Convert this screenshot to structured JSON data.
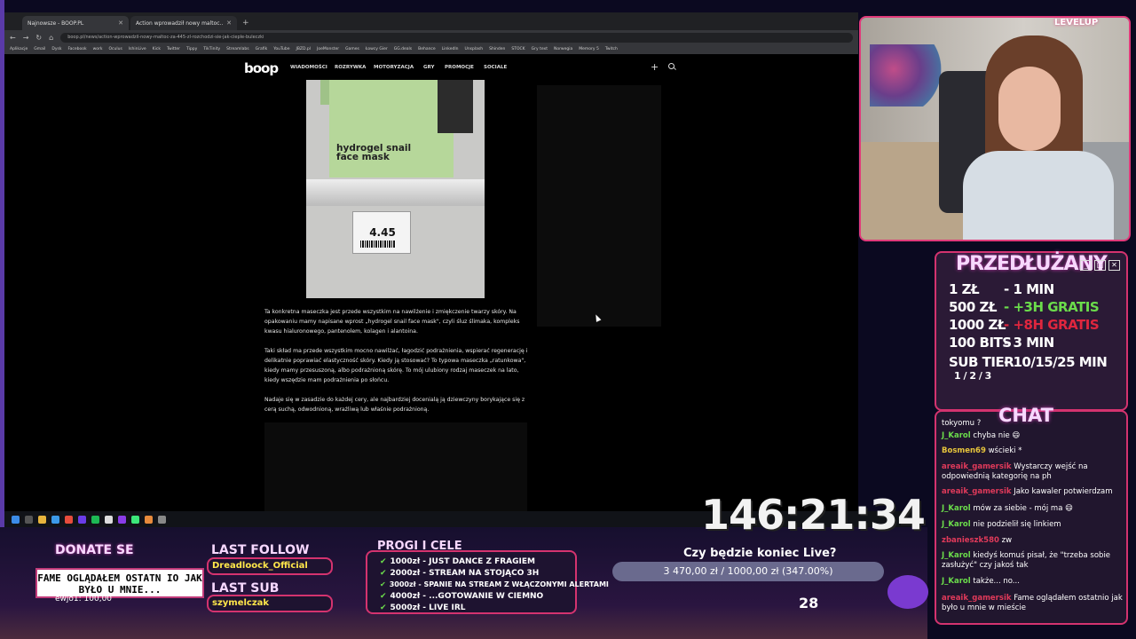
{
  "browser": {
    "tabs": [
      {
        "label": "Najnowsze - BOOP.PL"
      },
      {
        "label": "Action wprowadził nowy maltoc..."
      }
    ],
    "url": "boop.pl/news/action-wprowadzil-nowy-maltoc-za-445-zl-rozchodzi-sie-jak-cieple-buleczki",
    "bookmarks": [
      "Aplikacje",
      "Gmail",
      "Dysk",
      "Facebook",
      "work",
      "Oculus",
      "IshinLive",
      "Kick",
      "Twitter",
      "Tippy",
      "TikTinity",
      "Streamlabs",
      "Grafik",
      "YouTube",
      "JBZD.pl",
      "JoeMonster",
      "Games",
      "Łowcy Gier",
      "GG.deals",
      "Behance",
      "LinkedIn",
      "Unsplash",
      "Shinden",
      "STOCK",
      "Gry text",
      "Norwegia",
      "Memory 5",
      "Twitch"
    ]
  },
  "site": {
    "logo": "boop",
    "menu": [
      "WIADOMOŚCI",
      "ROZRYWKA",
      "MOTORYZACJA",
      "GRY",
      "PROMOCJE",
      "SOCIALE"
    ],
    "photo": {
      "product_text": "hydrogel snail face mask",
      "price": "4.45"
    },
    "paragraphs": [
      "Ta konkretna maseczka jest przede wszystkim na nawilżenie i zmiękczenie twarzy skóry. Na opakowaniu mamy napisane wprost „hydrogel snail face mask\", czyli śluz ślimaka, kompleks kwasu hialuronowego, pantenolem, kolagen i alantoina.",
      "Taki skład ma przede wszystkim mocno nawilżać, łagodzić podrażnienia, wspierać regenerację i delikatnie poprawiać elastyczność skóry. Kiedy ją stosować? To typowa maseczka „ratunkowa\", kiedy mamy przesuszoną, albo podrażnioną skórę. To mój ulubiony rodzaj maseczek na lato, kiedy wszędzie mam podrażnienia po słońcu.",
      "Nadaje się w zasadzie do każdej cery, ale najbardziej docenialą ją dziewczyny borykające się z cerą suchą, odwodnioną, wrażliwą lub właśnie podrażnioną."
    ]
  },
  "overlay": {
    "brand": "LEVELUP",
    "extension_title": "PRZEDŁUŻANY",
    "prices": [
      {
        "amount": "1 ZŁ",
        "value": "- 1 MIN",
        "color": "#ffffff"
      },
      {
        "amount": "500 ZŁ",
        "value": "- +3H GRATIS",
        "color": "#6bdc4b"
      },
      {
        "amount": "1000 ZŁ",
        "value": "- +8H GRATIS",
        "color": "#e0263e"
      },
      {
        "amount": "100 BITS",
        "value": "- 3 MIN",
        "color": "#ffffff"
      },
      {
        "amount": "SUB TIER",
        "value": "- 10/15/25 MIN",
        "color": "#ffffff"
      }
    ],
    "sub_tiers": "1 / 2 / 3",
    "chat_title": "CHAT",
    "chat": [
      {
        "user": "",
        "text": "tokyomu ?"
      },
      {
        "user": "J_Karol",
        "text": "chyba nie 😄"
      },
      {
        "user": "Bosmen69",
        "text": "wścieki *"
      },
      {
        "user": "areaik_gamersik",
        "text": "Wystarczy wejść na odpowiednią kategorię na ph"
      },
      {
        "user": "areaik_gamersik",
        "text": "Jako kawaler potwierdzam"
      },
      {
        "user": "J_Karol",
        "text": "mów za siebie - mój ma 😄"
      },
      {
        "user": "J_Karol",
        "text": "nie podzielił się linkiem"
      },
      {
        "user": "zbanieszk580",
        "text": "zw"
      },
      {
        "user": "J_Karol",
        "text": "kiedyś komuś pisał, że \"trzeba sobie zasłużyć\" czy jakoś tak"
      },
      {
        "user": "J_Karol",
        "text": "także... no..."
      },
      {
        "user": "areaik_gamersik",
        "text": "Fame oglądałem ostatnio jak było u mnie w mieście"
      }
    ],
    "timer": "146:21:34",
    "goal_question": "Czy będzie koniec Live?",
    "goal_progress": "3 470,00 zł / 1000,00 zł (347.00%)",
    "goal_percent": 347,
    "donate_title": "DONATE SE",
    "donate_message": "FAME OGLĄDAŁEM OSTATN IO JAK BYŁO U MNIE...",
    "donate_log": "ewjo1: 100,00",
    "last_follow_title": "LAST FOLLOW",
    "last_follow": "Dreadloock_Official",
    "last_sub_title": "LAST SUB",
    "last_sub": "szymelczak",
    "goals_title": "PROGI I CELE",
    "goals": [
      "1000zł - JUST DANCE Z FRAGIEM",
      "2000zł - STREAM NA STOJĄCO 3H",
      "3000zł - SPANIE NA STREAM Z WŁĄCZONYMI ALERTAMI",
      "4000zł - ...GOTOWANIE W CIEMNO",
      "5000zł - LIVE IRL"
    ],
    "viewers": "28"
  }
}
